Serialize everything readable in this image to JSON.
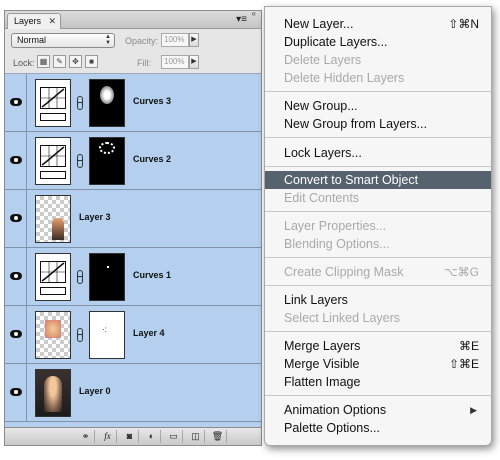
{
  "palette": {
    "tab_label": "Layers",
    "tab_close": "✕",
    "collapse_icon": "«",
    "menu_icon": "▾≡",
    "blend_mode": "Normal",
    "opacity_label": "Opacity:",
    "opacity_value": "100%",
    "lock_label": "Lock:",
    "fill_label": "Fill:",
    "fill_value": "100%",
    "layers": [
      {
        "name": "Curves 3",
        "type": "adjustment"
      },
      {
        "name": "Curves 2",
        "type": "adjustment"
      },
      {
        "name": "Layer 3",
        "type": "pixel"
      },
      {
        "name": "Curves 1",
        "type": "adjustment"
      },
      {
        "name": "Layer 4",
        "type": "pixel-mask"
      },
      {
        "name": "Layer 0",
        "type": "pixel"
      }
    ],
    "bottom_buttons": [
      "link-layers",
      "fx",
      "add-mask",
      "adjustment",
      "new-group",
      "new-layer",
      "delete"
    ]
  },
  "menu": {
    "items": [
      {
        "label": "New Layer...",
        "shortcut": "⇧⌘N",
        "enabled": true
      },
      {
        "label": "Duplicate Layers...",
        "shortcut": "",
        "enabled": true
      },
      {
        "label": "Delete Layers",
        "shortcut": "",
        "enabled": false
      },
      {
        "label": "Delete Hidden Layers",
        "shortcut": "",
        "enabled": false
      },
      {
        "label": "New Group...",
        "shortcut": "",
        "enabled": true
      },
      {
        "label": "New Group from Layers...",
        "shortcut": "",
        "enabled": true
      },
      {
        "label": "Lock Layers...",
        "shortcut": "",
        "enabled": true
      },
      {
        "label": "Convert to Smart Object",
        "shortcut": "",
        "enabled": true,
        "highlighted": true
      },
      {
        "label": "Edit Contents",
        "shortcut": "",
        "enabled": false
      },
      {
        "label": "Layer Properties...",
        "shortcut": "",
        "enabled": false
      },
      {
        "label": "Blending Options...",
        "shortcut": "",
        "enabled": false
      },
      {
        "label": "Create Clipping Mask",
        "shortcut": "⌥⌘G",
        "enabled": false
      },
      {
        "label": "Link Layers",
        "shortcut": "",
        "enabled": true
      },
      {
        "label": "Select Linked Layers",
        "shortcut": "",
        "enabled": false
      },
      {
        "label": "Merge Layers",
        "shortcut": "⌘E",
        "enabled": true
      },
      {
        "label": "Merge Visible",
        "shortcut": "⇧⌘E",
        "enabled": true
      },
      {
        "label": "Flatten Image",
        "shortcut": "",
        "enabled": true
      },
      {
        "label": "Animation Options",
        "shortcut": "",
        "enabled": true,
        "submenu": true
      },
      {
        "label": "Palette Options...",
        "shortcut": "",
        "enabled": true
      }
    ]
  },
  "colors": {
    "layer_selected_bg": "#b4d0ee",
    "menu_highlight": "#57626f",
    "menu_disabled_text": "#a9a9a9"
  }
}
